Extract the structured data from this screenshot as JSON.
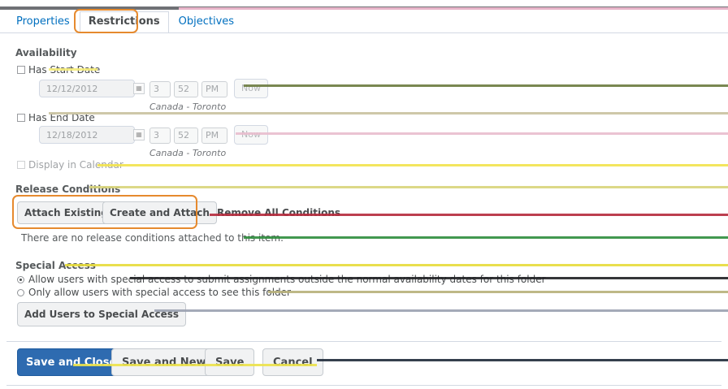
{
  "tabs": [
    {
      "label": "Properties"
    },
    {
      "label": "Restrictions"
    },
    {
      "label": "Objectives"
    }
  ],
  "availability": {
    "title": "Availability",
    "start": {
      "checkbox_label": "Has Start Date",
      "date": "12/12/2012",
      "hour": "3",
      "minute": "52",
      "ampm": "PM",
      "now_label": "Now",
      "timezone": "Canada - Toronto"
    },
    "end": {
      "checkbox_label": "Has End Date",
      "date": "12/18/2012",
      "hour": "3",
      "minute": "52",
      "ampm": "PM",
      "now_label": "Now",
      "timezone": "Canada - Toronto"
    },
    "calendar_label": "Display in Calendar"
  },
  "release": {
    "title": "Release Conditions",
    "attach_existing": "Attach Existing",
    "create_attach": "Create and Attach",
    "remove_all": "Remove All Conditions",
    "empty_text": "There are no release conditions attached to this item."
  },
  "special_access": {
    "title": "Special Access",
    "option1": "Allow users with special access to submit assignments outside the normal availability dates for this folder",
    "option2": "Only allow users with special access to see this folder",
    "add_button": "Add Users to Special Access"
  },
  "footer": {
    "save_close": "Save and Close",
    "save_new": "Save and New",
    "save": "Save",
    "cancel": "Cancel"
  }
}
